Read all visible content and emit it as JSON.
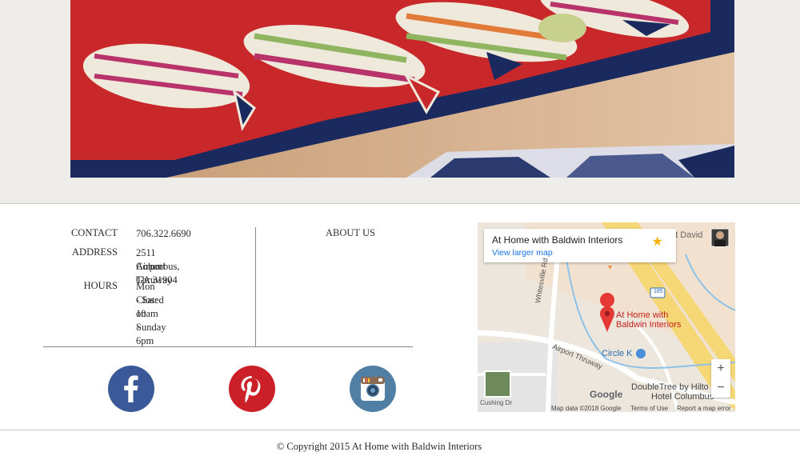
{
  "contact": {
    "contact_label": "CONTACT",
    "phone": "706.322.6690",
    "address_label": "ADDRESS",
    "address_line1": "2511 Airport Thruway",
    "address_line2": "Columbus, GA 31904",
    "hours_label": "HOURS",
    "hours_line1": "Mon - Sat: 10am - 6pm",
    "hours_line2": "Closed on Sunday"
  },
  "about": {
    "label": "ABOUT US"
  },
  "social": [
    {
      "icon": "facebook-icon",
      "color": "#3b5998"
    },
    {
      "icon": "pinterest-icon",
      "color": "#cb2027"
    },
    {
      "icon": "instagram-icon",
      "color": "#517fa4"
    }
  ],
  "map": {
    "place_title": "At Home with Baldwin Interiors",
    "larger_map_link": "View larger map",
    "pin_label_line1": "At Home with",
    "pin_label_line2": "Baldwin Interiors",
    "road_whitesville": "Whitesville Rd",
    "road_airport": "Airport Thruway",
    "road_cushing": "Cushing Dr",
    "poi_circle_k": "Circle K",
    "poi_doubletree_1": "DoubleTree by Hilto",
    "poi_doubletree_2": "Hotel Columbus",
    "poi_partial": "ritt David",
    "highway_shield": "185",
    "google_logo": "Google",
    "map_data": "Map data ©2018 Google",
    "terms": "Terms of Use",
    "report": "Report a map error",
    "zoom_in": "+",
    "zoom_out": "−"
  },
  "footer": {
    "copyright": "© Copyright 2015 At Home with Baldwin Interiors"
  },
  "colors": {
    "band": "#efedea",
    "rug_red": "#c8282a",
    "rug_navy": "#1b2a5e",
    "link_blue": "#1a73e8"
  }
}
